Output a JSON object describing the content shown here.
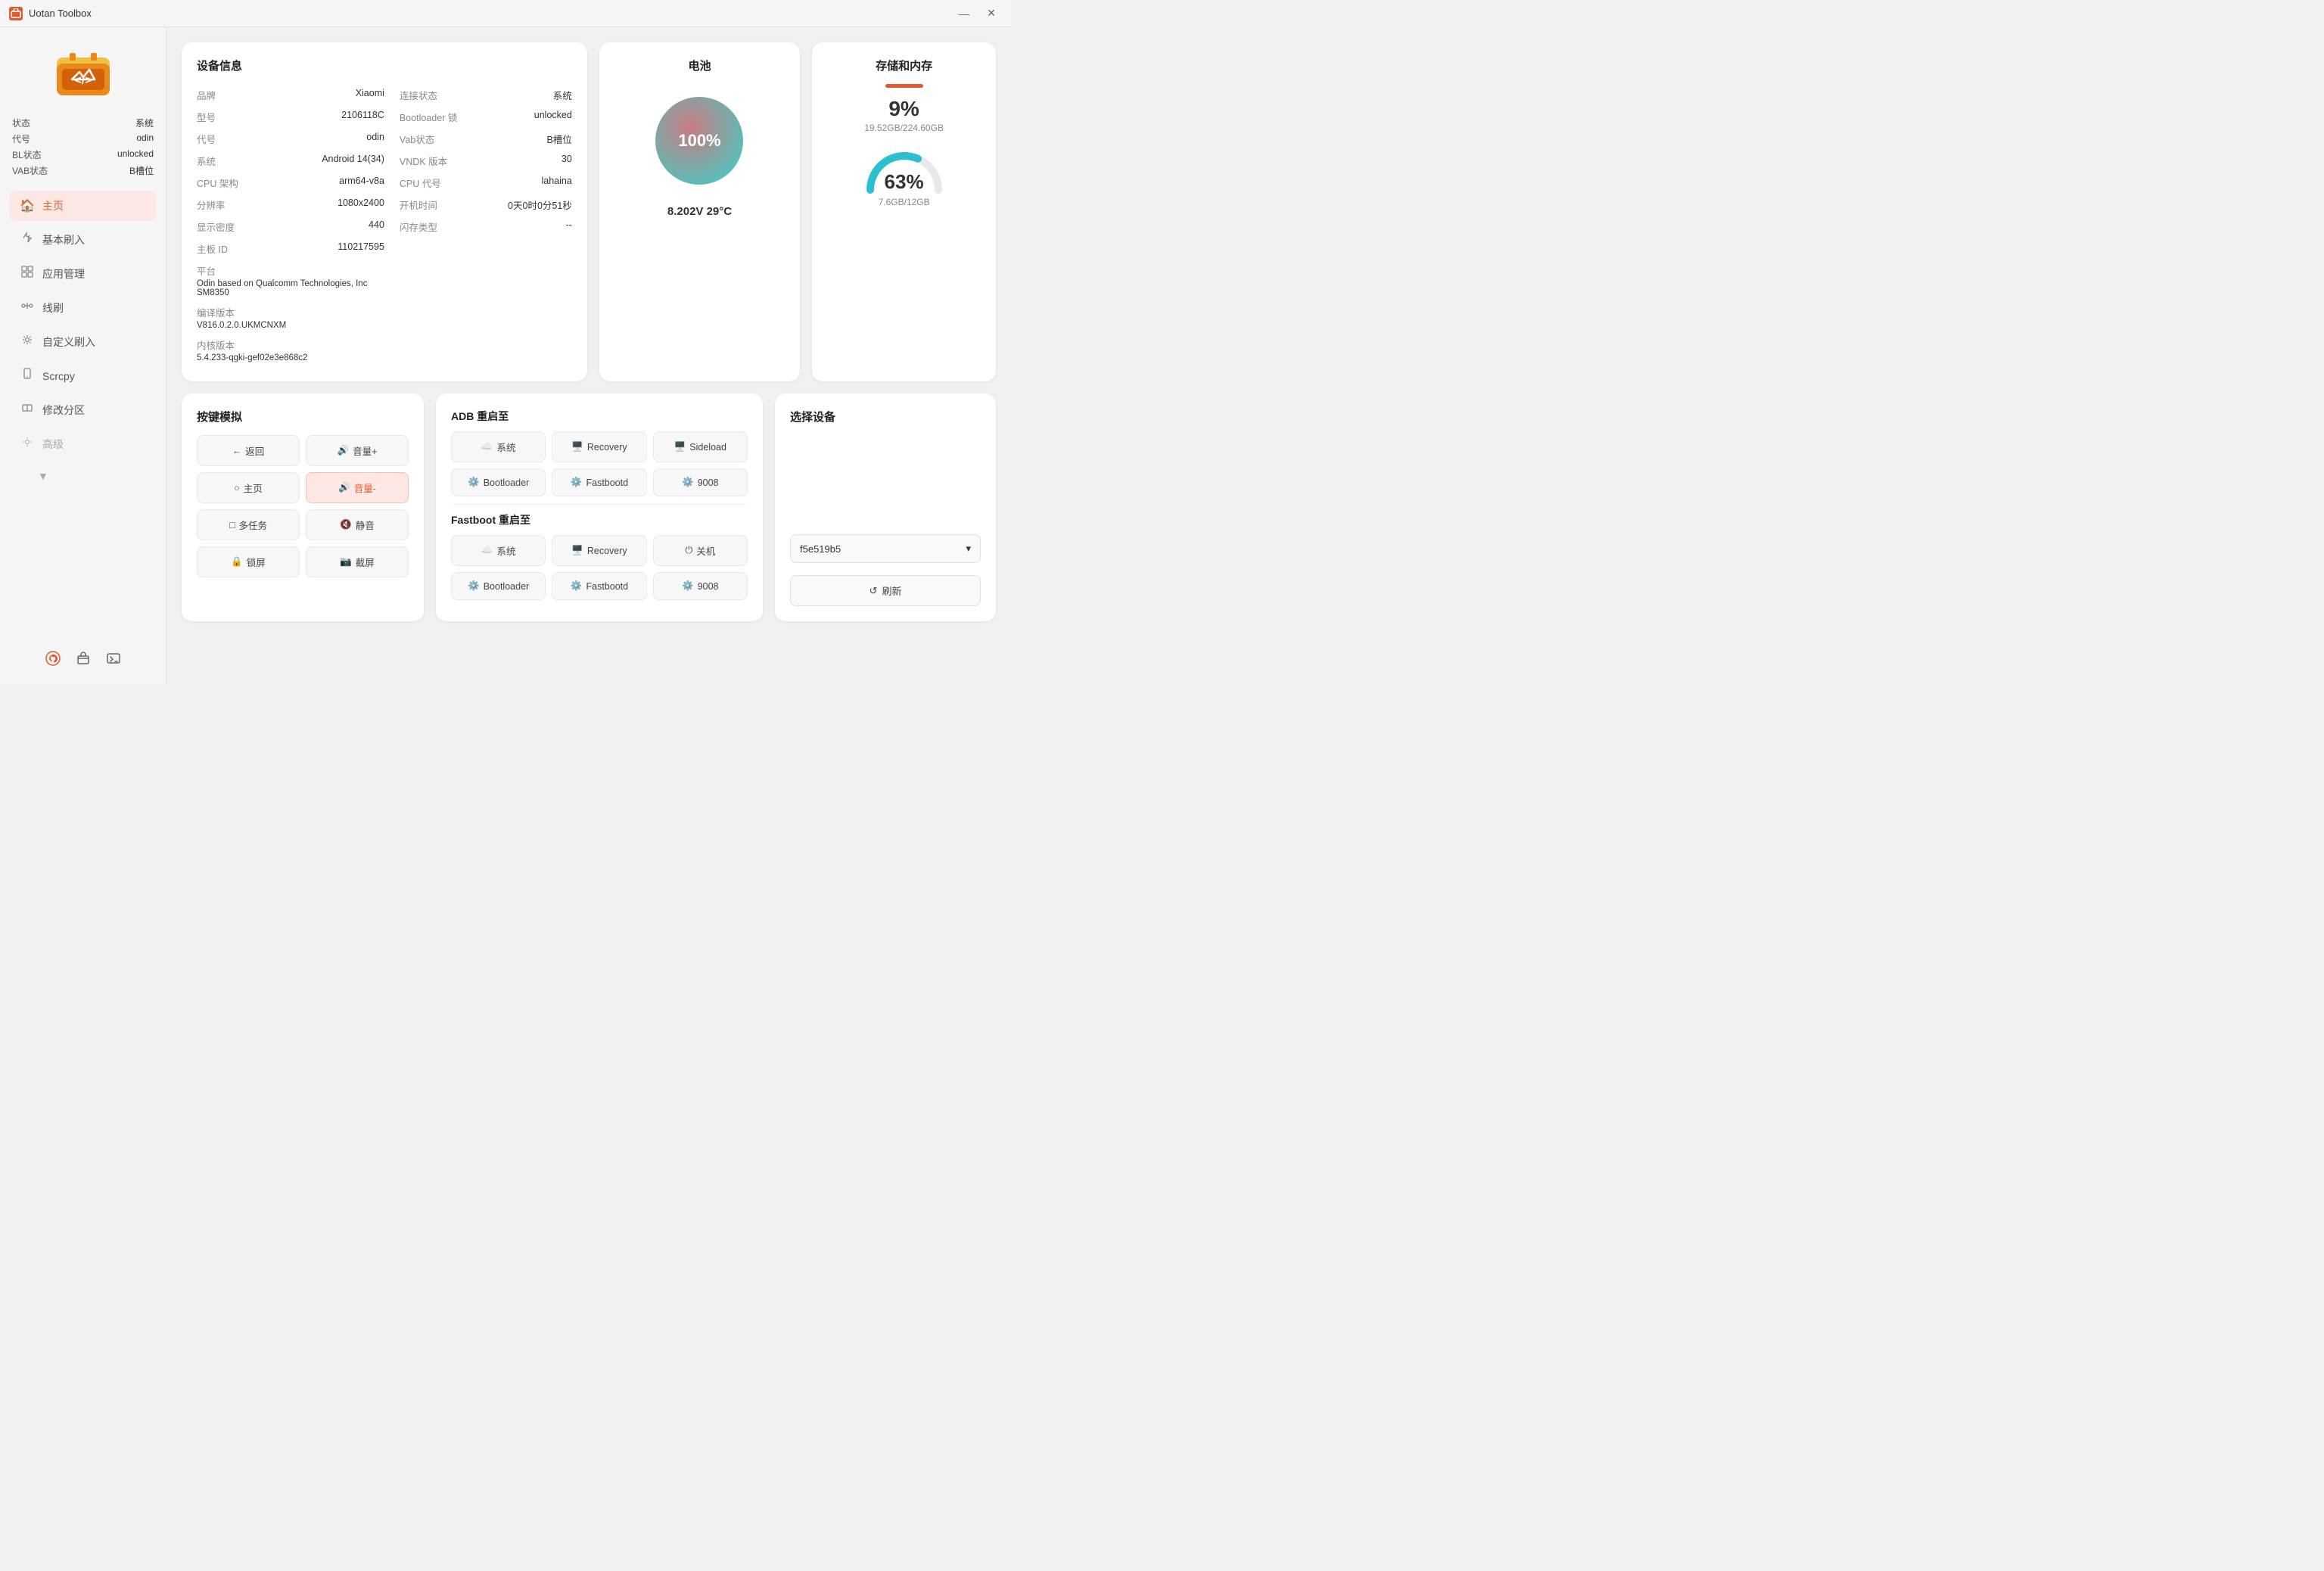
{
  "titlebar": {
    "title": "Uotan Toolbox",
    "minimize": "—",
    "close": "✕"
  },
  "sidebar": {
    "logo_alt": "Uotan Logo",
    "status": [
      {
        "label": "状态",
        "value": "系统"
      },
      {
        "label": "代号",
        "value": "odin"
      },
      {
        "label": "BL状态",
        "value": "unlocked"
      },
      {
        "label": "VAB状态",
        "value": "B槽位"
      }
    ],
    "nav": [
      {
        "id": "home",
        "label": "主页",
        "icon": "🏠",
        "active": true
      },
      {
        "id": "flash",
        "label": "基本刷入",
        "icon": "✏️",
        "active": false
      },
      {
        "id": "apps",
        "label": "应用管理",
        "icon": "⚙️",
        "active": false
      },
      {
        "id": "wire",
        "label": "线刷",
        "icon": "🔧",
        "active": false
      },
      {
        "id": "custom",
        "label": "自定义刷入",
        "icon": "🔧",
        "active": false
      },
      {
        "id": "scrcpy",
        "label": "Scrcpy",
        "icon": "📱",
        "active": false
      },
      {
        "id": "partition",
        "label": "修改分区",
        "icon": "🔧",
        "active": false
      },
      {
        "id": "advanced",
        "label": "高级",
        "icon": "🔧",
        "active": false
      }
    ],
    "more_label": "▼",
    "bottom_icons": [
      "github",
      "box",
      "terminal"
    ]
  },
  "device_info": {
    "title": "设备信息",
    "rows_left": [
      {
        "label": "品牌",
        "value": "Xiaomi"
      },
      {
        "label": "型号",
        "value": "2106118C"
      },
      {
        "label": "代号",
        "value": "odin"
      },
      {
        "label": "系统",
        "value": "Android 14(34)"
      },
      {
        "label": "CPU 架构",
        "value": "arm64-v8a"
      },
      {
        "label": "分辨率",
        "value": "1080x2400"
      },
      {
        "label": "显示密度",
        "value": "440"
      },
      {
        "label": "主板 ID",
        "value": "110217595"
      },
      {
        "label": "平台",
        "value": "Odin based on Qualcomm Technologies, Inc SM8350"
      },
      {
        "label": "编译版本",
        "value": "V816.0.2.0.UKMCNXM"
      },
      {
        "label": "内核版本",
        "value": "5.4.233-qgki-gef02e3e868c2"
      }
    ],
    "rows_right": [
      {
        "label": "连接状态",
        "value": "系统"
      },
      {
        "label": "Bootloader 锁",
        "value": "unlocked"
      },
      {
        "label": "Vab状态",
        "value": "B槽位"
      },
      {
        "label": "VNDK 版本",
        "value": "30"
      },
      {
        "label": "CPU 代号",
        "value": "lahaina"
      },
      {
        "label": "开机时间",
        "value": "0天0时0分51秒"
      },
      {
        "label": "闪存类型",
        "value": "--"
      }
    ]
  },
  "battery": {
    "title": "电池",
    "percentage": "100%",
    "voltage": "8.202V",
    "temperature": "29°C",
    "info_text": "8.202V 29°C"
  },
  "storage": {
    "title": "存储和内存",
    "storage_pct": "9%",
    "storage_used": "19.52GB",
    "storage_total": "224.60GB",
    "storage_label": "19.52GB/224.60GB",
    "memory_pct": "63%",
    "memory_used": "7.6GB",
    "memory_total": "12GB",
    "memory_label": "7.6GB/12GB"
  },
  "key_sim": {
    "title": "按键模拟",
    "buttons": [
      {
        "label": "← 返回",
        "active": false
      },
      {
        "label": "🔊 音量+",
        "active": false
      },
      {
        "label": "○ 主页",
        "active": false
      },
      {
        "label": "🔊 音量-",
        "active": true
      },
      {
        "label": "□ 多任务",
        "active": false
      },
      {
        "label": "🔇 静音",
        "active": false
      },
      {
        "label": "🔒 锁屏",
        "active": false
      },
      {
        "label": "📷 截屏",
        "active": false
      }
    ]
  },
  "adb_reboot": {
    "title": "ADB 重启至",
    "buttons": [
      {
        "label": "系统",
        "icon": "☁️"
      },
      {
        "label": "Recovery",
        "icon": "🖥️"
      },
      {
        "label": "Sideload",
        "icon": "🖥️"
      },
      {
        "label": "Bootloader",
        "icon": "⚙️"
      },
      {
        "label": "Fastbootd",
        "icon": "⚙️"
      },
      {
        "label": "9008",
        "icon": "⚙️"
      }
    ]
  },
  "fastboot_reboot": {
    "title": "Fastboot 重启至",
    "buttons": [
      {
        "label": "系统",
        "icon": "☁️"
      },
      {
        "label": "Recovery",
        "icon": "🖥️"
      },
      {
        "label": "关机",
        "icon": "⏻"
      },
      {
        "label": "Bootloader",
        "icon": "⚙️"
      },
      {
        "label": "Fastbootd",
        "icon": "⚙️"
      },
      {
        "label": "9008",
        "icon": "⚙️"
      }
    ]
  },
  "device_select": {
    "title": "选择设备",
    "device_id": "f5e519b5",
    "refresh_label": "↺ 刷新"
  }
}
